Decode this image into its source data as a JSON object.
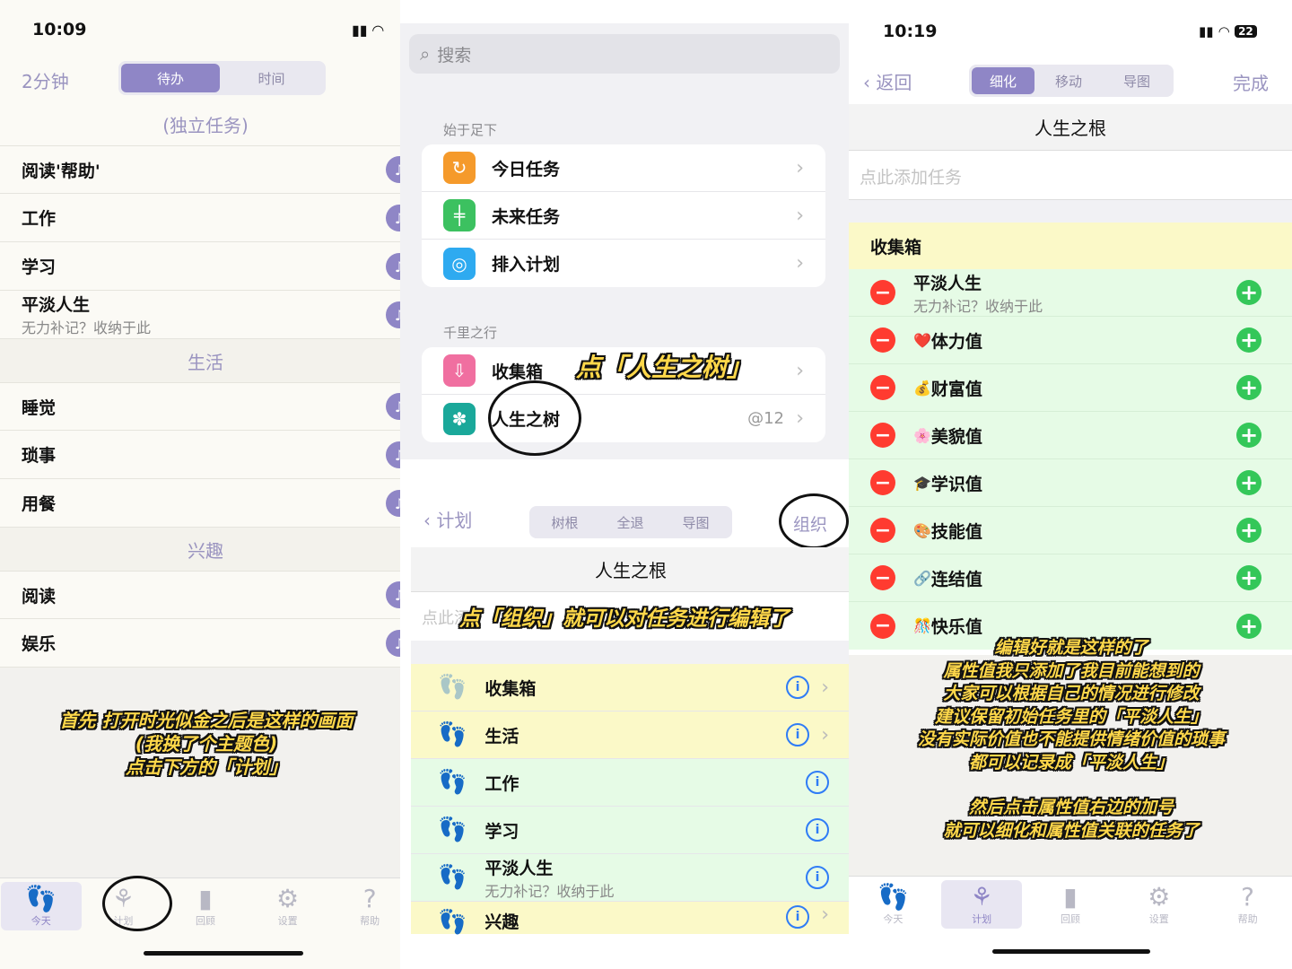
{
  "left": {
    "status_time": "10:09",
    "duration": "2分钟",
    "seg": [
      "待办",
      "时间"
    ],
    "group_independent": "(独立任务)",
    "rows1": [
      "阅读'帮助'",
      "工作",
      "学习"
    ],
    "row_plain": {
      "title": "平淡人生",
      "subtitle": "无力补记？收纳于此"
    },
    "group_life": "生活",
    "rows2": [
      "睡觉",
      "琐事",
      "用餐"
    ],
    "group_hobby": "兴趣",
    "rows3": [
      "阅读",
      "娱乐"
    ],
    "caption": [
      "首先 打开时光似金之后是这样的画面",
      "(我换了个主题色)",
      "点击下方的「计划」"
    ],
    "tabs": [
      "今天",
      "计划",
      "回顾",
      "设置",
      "帮助"
    ]
  },
  "middle": {
    "search_placeholder": "搜索",
    "group1": "始于足下",
    "items1": [
      "今日任务",
      "未来任务",
      "排入计划"
    ],
    "group2": "千里之行",
    "items2": [
      "收集箱",
      "人生之树"
    ],
    "badge": "@12",
    "annot1": "点「人生之树」",
    "nav_back": "计划",
    "seg": [
      "树根",
      "全退",
      "导图"
    ],
    "organize": "组织",
    "root_title": "人生之根",
    "add_hint": "点此添",
    "annot2": "点「组织」就可以对任务进行编辑了",
    "list": [
      {
        "title": "收集箱",
        "subtitle": ""
      },
      {
        "title": "生活",
        "subtitle": ""
      },
      {
        "title": "工作",
        "subtitle": ""
      },
      {
        "title": "学习",
        "subtitle": ""
      },
      {
        "title": "平淡人生",
        "subtitle": "无力补记？收纳于此"
      },
      {
        "title": "兴趣",
        "subtitle": ""
      }
    ]
  },
  "right": {
    "status_time": "10:19",
    "battery": "22",
    "back": "返回",
    "seg": [
      "细化",
      "移动",
      "导图"
    ],
    "done": "完成",
    "root_title": "人生之根",
    "add_hint": "点此添加任务",
    "inbox": "收集箱",
    "rows": [
      {
        "emoji": "",
        "title": "平淡人生",
        "subtitle": "无力补记？收纳于此"
      },
      {
        "emoji": "❤️",
        "title": "体力值",
        "subtitle": ""
      },
      {
        "emoji": "💰",
        "title": "财富值",
        "subtitle": ""
      },
      {
        "emoji": "🌸",
        "title": "美貌值",
        "subtitle": ""
      },
      {
        "emoji": "🎓",
        "title": "学识值",
        "subtitle": ""
      },
      {
        "emoji": "🎨",
        "title": "技能值",
        "subtitle": ""
      },
      {
        "emoji": "🔗",
        "title": "连结值",
        "subtitle": ""
      },
      {
        "emoji": "🎊",
        "title": "快乐值",
        "subtitle": ""
      }
    ],
    "caption": [
      "编辑好就是这样的了",
      "属性值我只添加了我目前能想到的",
      "大家可以根据自己的情况进行修改",
      "建议保留初始任务里的「平淡人生」",
      "没有实际价值也不能提供情绪价值的琐事",
      "都可以记录成「平淡人生」",
      "",
      "然后点击属性值右边的加号",
      "就可以细化和属性值关联的任务了"
    ],
    "tabs": [
      "今天",
      "计划",
      "回顾",
      "设置",
      "帮助"
    ]
  }
}
